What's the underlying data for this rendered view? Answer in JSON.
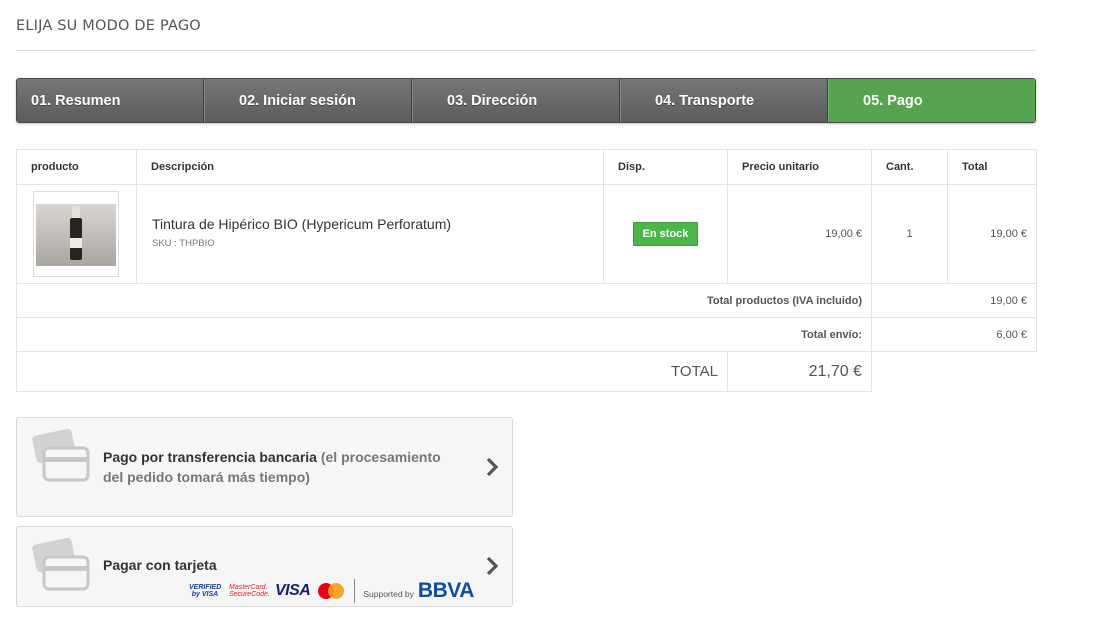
{
  "page": {
    "title": "ELIJA SU MODO DE PAGO"
  },
  "steps": [
    {
      "label": "01. Resumen"
    },
    {
      "label": "02. Iniciar sesión"
    },
    {
      "label": "03. Dirección"
    },
    {
      "label": "04. Transporte"
    },
    {
      "label": "05. Pago",
      "active": true
    }
  ],
  "cart": {
    "headers": {
      "product": "producto",
      "description": "Descripción",
      "availability": "Disp.",
      "unit_price": "Precio unitario",
      "qty": "Cant.",
      "total": "Total"
    },
    "items": [
      {
        "name": "Tintura de Hipérico BIO (Hypericum Perforatum)",
        "sku": "SKU : THPBIO",
        "stock": "En stock",
        "unit_price": "19,00 €",
        "qty": "1",
        "total": "19,00 €"
      }
    ],
    "summary": {
      "products_label": "Total productos (IVA incluido)",
      "products_value": "19,00 €",
      "shipping_label": "Total envío:",
      "shipping_value": "6,00 €",
      "grand_label": "TOTAL",
      "grand_value": "21,70 €"
    }
  },
  "payment": {
    "transfer": {
      "title": "Pago por transferencia bancaria",
      "note": "(el procesamiento del pedido tomará más tiempo)"
    },
    "card": {
      "title": "Pagar con tarjeta",
      "logos": {
        "verified": "VERIFIED by VISA",
        "mc_securecode": "MasterCard. SecureCode.",
        "visa": "VISA",
        "supported": "Supported by",
        "bbva": "BBVA"
      }
    }
  },
  "colors": {
    "step_active": "#57a450",
    "step_default": "#666666",
    "stock_badge": "#4cb748"
  }
}
